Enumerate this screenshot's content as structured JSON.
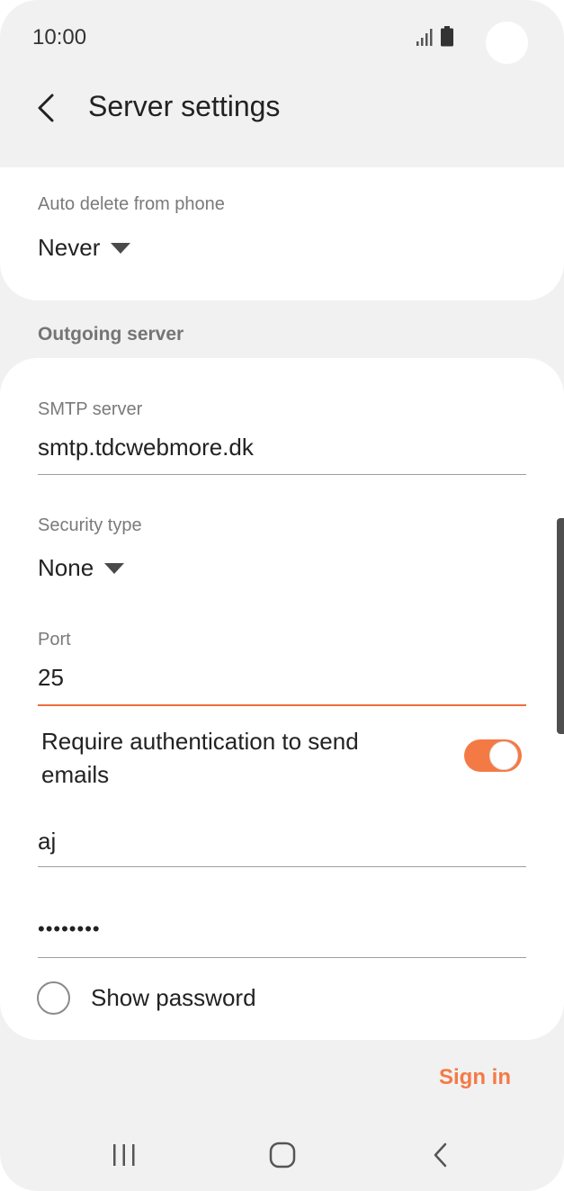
{
  "status_bar": {
    "time": "10:00"
  },
  "header": {
    "title": "Server settings",
    "back_icon": "chevron-left-icon"
  },
  "incoming": {
    "auto_delete_label": "Auto delete from phone",
    "auto_delete_value": "Never"
  },
  "outgoing": {
    "section_title": "Outgoing server",
    "smtp_label": "SMTP server",
    "smtp_value": "smtp.tdcwebmore.dk",
    "security_label": "Security type",
    "security_value": "None",
    "port_label": "Port",
    "port_value": "25",
    "require_auth_label": "Require authentication to send emails",
    "require_auth_on": true,
    "username_value": "aj",
    "password_value": "••••••••",
    "show_password_label": "Show password",
    "show_password_checked": false
  },
  "actions": {
    "sign_in_label": "Sign in"
  },
  "colors": {
    "accent": "#f47a45",
    "active_underline": "#ef6c3f",
    "background": "#f1f1f1",
    "card": "#ffffff"
  },
  "nav": {
    "recents_icon": "recents-icon",
    "home_icon": "home-icon",
    "back_icon": "back-icon"
  }
}
